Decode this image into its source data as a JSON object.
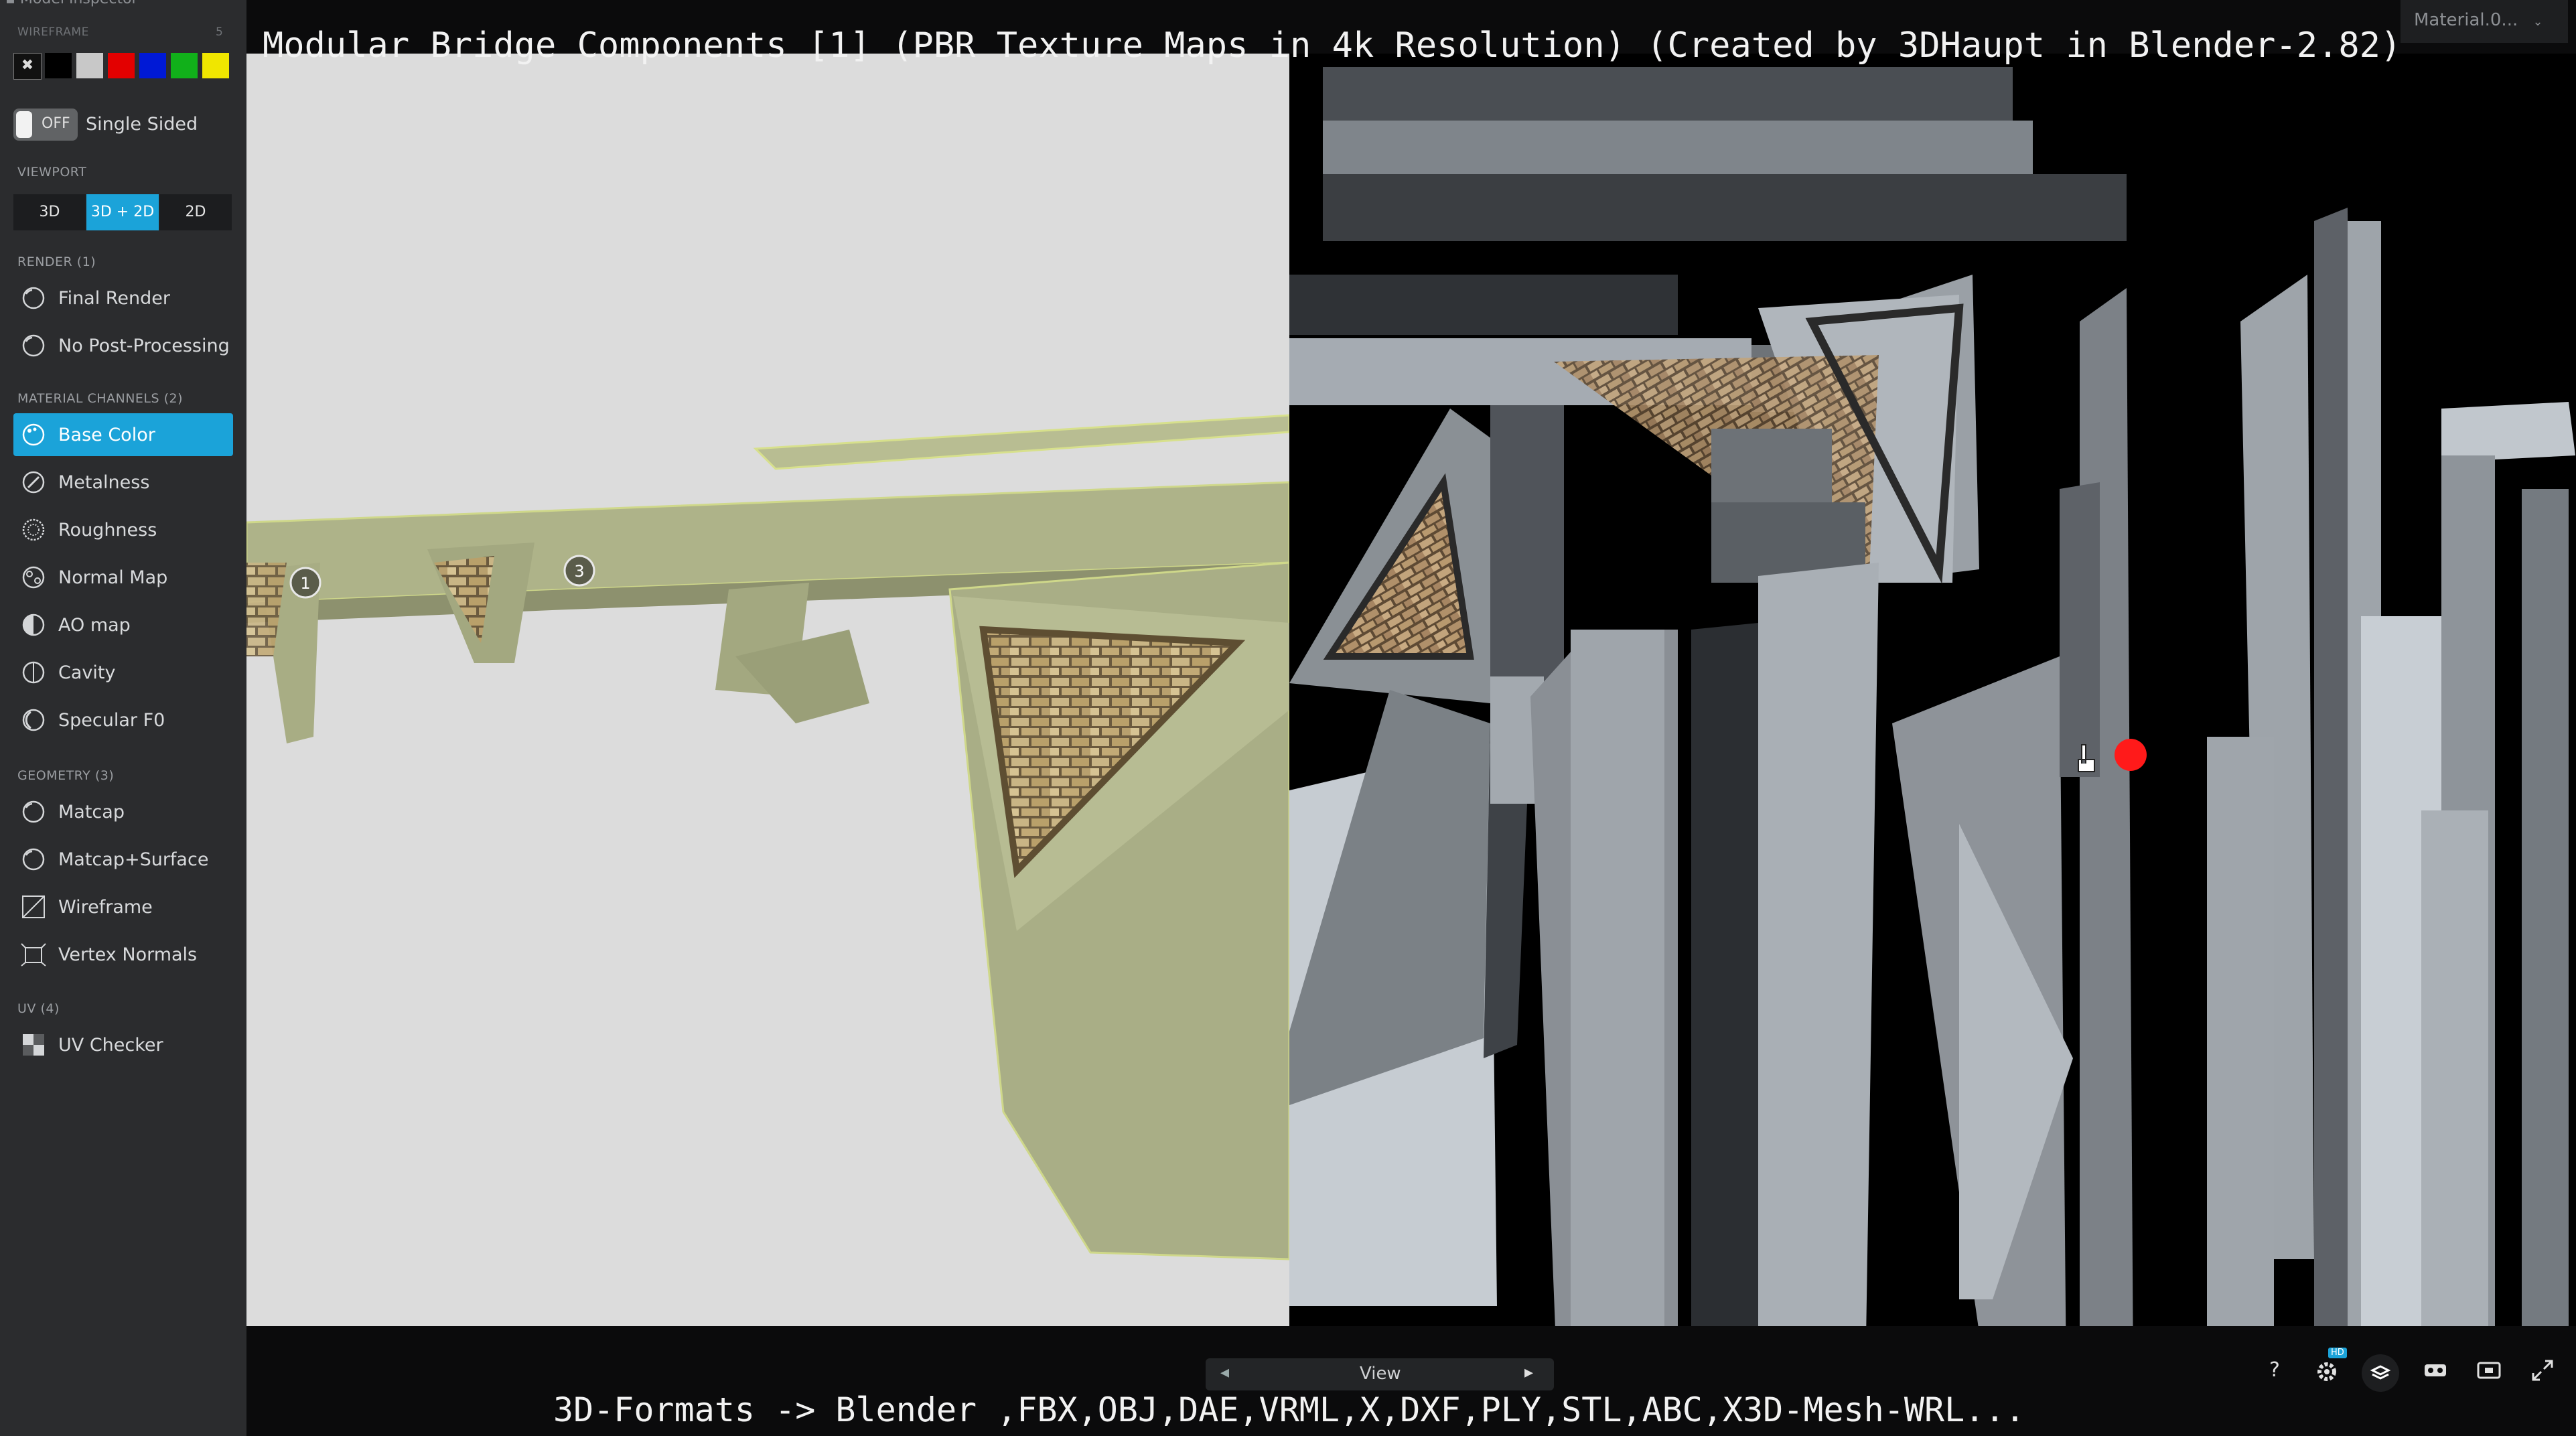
{
  "title": "Modular Bridge Components [1] (PBR Texture Maps in 4k Resolution) (Created by 3DHaupt in Blender-2.82)",
  "footer": "3D-Formats -> Blender ,FBX,OBJ,DAE,VRML,X,DXF,PLY,STL,ABC,X3D-Mesh-WRL...",
  "sidebar": {
    "header": "Model Inspector",
    "wireframe_label": "WIREFRAME",
    "wireframe_value": "5",
    "swatch_colors": [
      "#111111",
      "#000000",
      "#c8c8c8",
      "#e30000",
      "#0019d6",
      "#11b01a",
      "#f0e600"
    ],
    "single_sided": {
      "toggle": "OFF",
      "label": "Single Sided"
    },
    "viewport": {
      "title": "VIEWPORT",
      "buttons": [
        "3D",
        "3D + 2D",
        "2D"
      ],
      "active": "3D + 2D"
    },
    "render": {
      "title": "RENDER (1)",
      "items": [
        {
          "label": "Final Render",
          "icon": "sphere-icon"
        },
        {
          "label": "No Post-Processing",
          "icon": "sphere-icon"
        }
      ]
    },
    "material_channels": {
      "title": "MATERIAL CHANNELS (2)",
      "items": [
        {
          "label": "Base Color",
          "icon": "palette-icon",
          "active": true
        },
        {
          "label": "Metalness",
          "icon": "metal-icon"
        },
        {
          "label": "Roughness",
          "icon": "roughness-icon"
        },
        {
          "label": "Normal Map",
          "icon": "normal-map-icon"
        },
        {
          "label": "AO map",
          "icon": "ao-icon"
        },
        {
          "label": "Cavity",
          "icon": "cavity-icon"
        },
        {
          "label": "Specular F0",
          "icon": "specular-icon"
        }
      ]
    },
    "geometry": {
      "title": "GEOMETRY (3)",
      "items": [
        {
          "label": "Matcap",
          "icon": "sphere-icon"
        },
        {
          "label": "Matcap+Surface",
          "icon": "sphere-icon"
        },
        {
          "label": "Wireframe",
          "icon": "wireframe-icon"
        },
        {
          "label": "Vertex Normals",
          "icon": "vertex-normals-icon"
        }
      ]
    },
    "uv": {
      "title": "UV (4)",
      "items": [
        {
          "label": "UV Checker",
          "icon": "checker-icon"
        }
      ]
    }
  },
  "viewer": {
    "annotations": [
      "1",
      "3"
    ],
    "material_dropdown": "Material.0...",
    "view_label": "View",
    "toolbar_icons": [
      "help-icon",
      "settings-hd-icon",
      "layers-icon",
      "vr-icon",
      "screenshot-icon",
      "fullscreen-icon"
    ],
    "hd_badge": "HD",
    "help_glyph": "?"
  }
}
